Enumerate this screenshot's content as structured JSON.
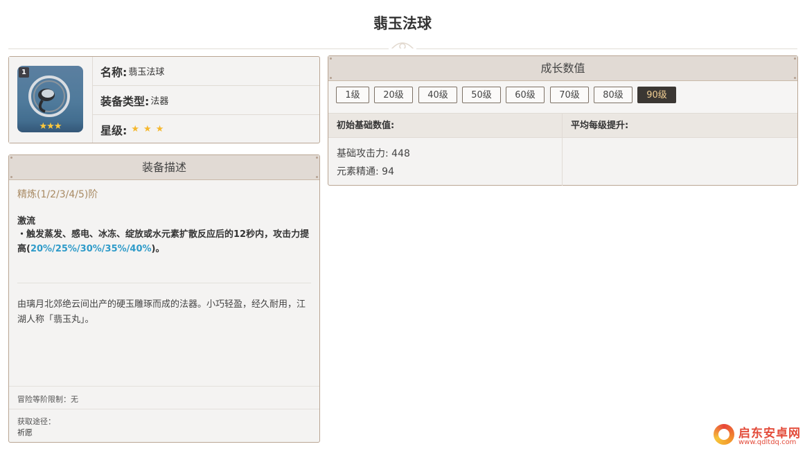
{
  "page": {
    "title": "翡玉法球"
  },
  "info": {
    "level_badge": "1",
    "name_label": "名称:",
    "name_value": "翡玉法球",
    "type_label": "装备类型:",
    "type_value": "法器",
    "rarity_label": "星级:",
    "rarity_stars": 3
  },
  "description": {
    "header": "装备描述",
    "refine": "精炼(1/2/3/4/5)阶",
    "skill_name": "激流",
    "skill_text_pre": "・触发蒸发、感电、冰冻、绽放或水元素扩散反应后的12秒内，攻击力提高(",
    "skill_values": "20%/25%/30%/35%/40%",
    "skill_text_post": ")。",
    "lore": "由璃月北郊绝云间出产的硬玉雕琢而成的法器。小巧轻盈，经久耐用，江湖人称「翡玉丸」。",
    "rank_limit": "冒险等阶限制：无",
    "source_label": "获取途径：",
    "source_value": "祈愿"
  },
  "growth": {
    "header": "成长数值",
    "levels": [
      "1级",
      "20级",
      "40级",
      "50级",
      "60级",
      "70级",
      "80级",
      "90级"
    ],
    "active_level": "90级",
    "col_base": "初始基础数值:",
    "col_avg": "平均每级提升:",
    "stat1": "基础攻击力: 448",
    "stat2": "元素精通: 94"
  },
  "watermark": {
    "name": "启东安卓网",
    "url": "www.qdltdq.com"
  },
  "colors": {
    "accent_gold": "#a88a63",
    "highlight_blue": "#2f9bc9",
    "star": "#f5b82e",
    "active_btn": "#3b3733"
  }
}
